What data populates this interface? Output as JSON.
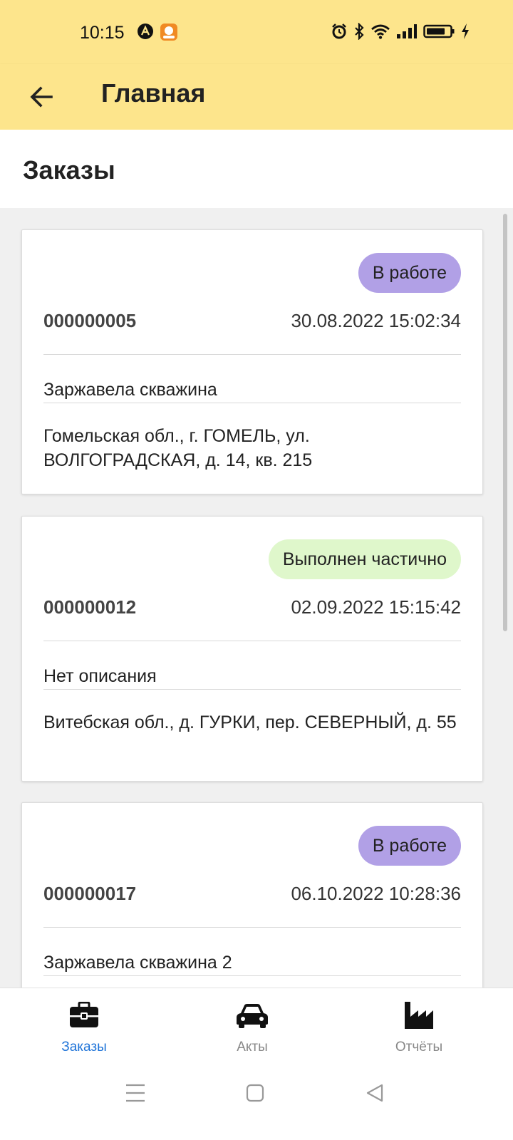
{
  "status_bar": {
    "time": "10:15"
  },
  "app_bar": {
    "title": "Главная"
  },
  "section": {
    "title": "Заказы"
  },
  "orders": [
    {
      "status": "В работе",
      "number": "000000005",
      "datetime": "30.08.2022 15:02:34",
      "description": "Заржавела скважина",
      "address": "Гомельская обл., г. ГОМЕЛЬ, ул. ВОЛГОГРАДСКАЯ, д. 14, кв. 215",
      "status_color": "#b1a0e6"
    },
    {
      "status": "Выполнен частично",
      "number": "000000012",
      "datetime": "02.09.2022 15:15:42",
      "description": "Нет описания",
      "address": "Витебская обл., д. ГУРКИ, пер. СЕВЕРНЫЙ, д. 55",
      "status_color": "#dff7cb"
    },
    {
      "status": "В работе",
      "number": "000000017",
      "datetime": "06.10.2022 10:28:36",
      "description": "Заржавела скважина 2",
      "address": "",
      "status_color": "#b1a0e6"
    }
  ],
  "bottom_nav": {
    "items": [
      {
        "label": "Заказы",
        "icon": "briefcase-icon",
        "active": true
      },
      {
        "label": "Акты",
        "icon": "car-icon",
        "active": false
      },
      {
        "label": "Отчёты",
        "icon": "factory-icon",
        "active": false
      }
    ]
  },
  "colors": {
    "app_bar": "#fde58c",
    "active_nav": "#1e73d8"
  }
}
